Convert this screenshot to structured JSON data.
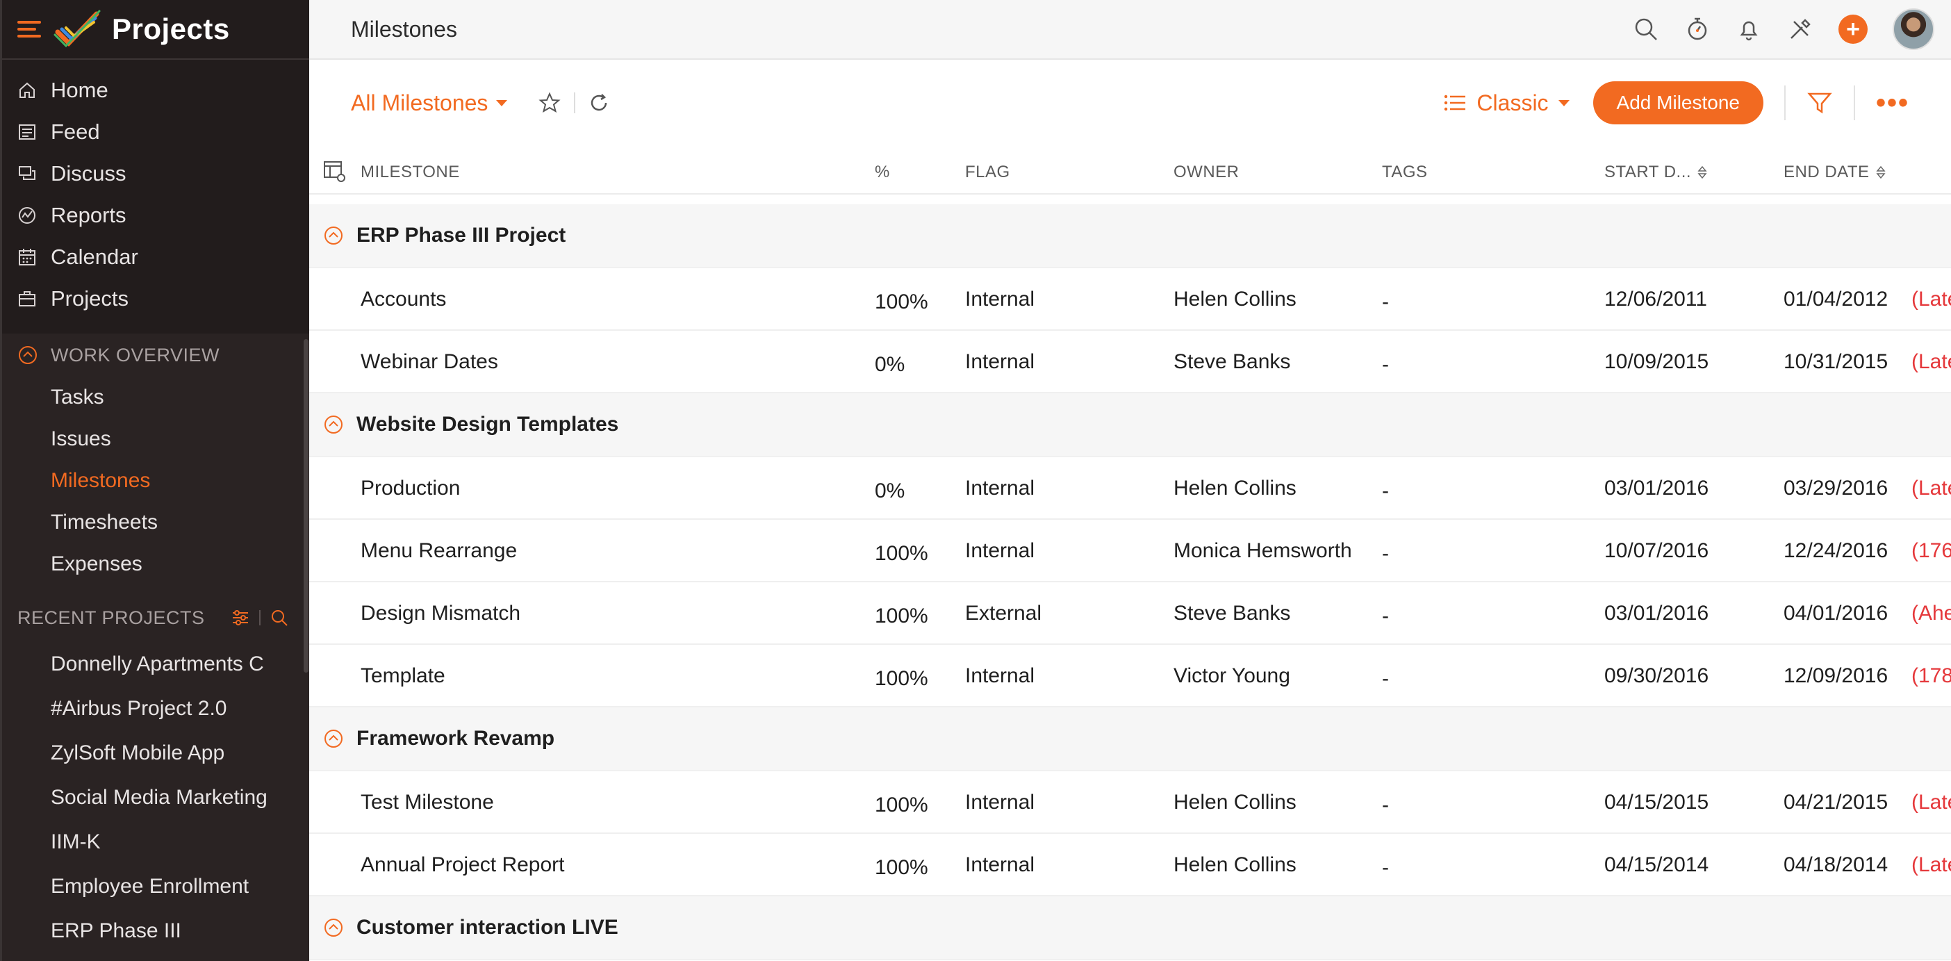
{
  "app": {
    "title": "Projects"
  },
  "sidebar": {
    "nav": [
      {
        "label": "Home",
        "icon": "home-icon"
      },
      {
        "label": "Feed",
        "icon": "feed-icon"
      },
      {
        "label": "Discuss",
        "icon": "discuss-icon"
      },
      {
        "label": "Reports",
        "icon": "reports-icon"
      },
      {
        "label": "Calendar",
        "icon": "calendar-icon"
      },
      {
        "label": "Projects",
        "icon": "projects-icon"
      }
    ],
    "work_overview": {
      "title": "WORK OVERVIEW",
      "items": [
        {
          "label": "Tasks",
          "active": false
        },
        {
          "label": "Issues",
          "active": false
        },
        {
          "label": "Milestones",
          "active": true
        },
        {
          "label": "Timesheets",
          "active": false
        },
        {
          "label": "Expenses",
          "active": false
        }
      ]
    },
    "recent_projects": {
      "title": "RECENT PROJECTS",
      "items": [
        "Donnelly Apartments C",
        "#Airbus Project 2.0",
        "ZylSoft Mobile App",
        "Social Media Marketing",
        "IIM-K",
        "Employee Enrollment",
        "ERP Phase III"
      ]
    }
  },
  "topbar": {
    "page_title": "Milestones"
  },
  "toolbar": {
    "view_label": "All Milestones",
    "layout_label": "Classic",
    "add_button": "Add Milestone"
  },
  "table": {
    "headers": {
      "milestone": "MILESTONE",
      "percent": "%",
      "flag": "FLAG",
      "owner": "OWNER",
      "tags": "TAGS",
      "start": "START D...",
      "end": "END DATE"
    },
    "groups": [
      {
        "name": "ERP Phase III Project",
        "rows": [
          {
            "name": "Accounts",
            "pct": "100%",
            "flag": "Internal",
            "owner": "Helen Collins",
            "tags": "-",
            "start": "12/06/2011",
            "end": "01/04/2012",
            "status": "(Late"
          },
          {
            "name": "Webinar Dates",
            "pct": "0%",
            "flag": "Internal",
            "owner": "Steve Banks",
            "tags": "-",
            "start": "10/09/2015",
            "end": "10/31/2015",
            "status": "(Late"
          }
        ]
      },
      {
        "name": "Website Design Templates",
        "rows": [
          {
            "name": "Production",
            "pct": "0%",
            "flag": "Internal",
            "owner": "Helen Collins",
            "tags": "-",
            "start": "03/01/2016",
            "end": "03/29/2016",
            "status": "(Late"
          },
          {
            "name": "Menu Rearrange",
            "pct": "100%",
            "flag": "Internal",
            "owner": "Monica Hemsworth",
            "tags": "-",
            "start": "10/07/2016",
            "end": "12/24/2016",
            "status": "(176"
          },
          {
            "name": "Design Mismatch",
            "pct": "100%",
            "flag": "External",
            "owner": "Steve Banks",
            "tags": "-",
            "start": "03/01/2016",
            "end": "04/01/2016",
            "status": "(Ahe"
          },
          {
            "name": "Template",
            "pct": "100%",
            "flag": "Internal",
            "owner": "Victor Young",
            "tags": "-",
            "start": "09/30/2016",
            "end": "12/09/2016",
            "status": "(178"
          }
        ]
      },
      {
        "name": "Framework Revamp",
        "rows": [
          {
            "name": "Test Milestone",
            "pct": "100%",
            "flag": "Internal",
            "owner": "Helen Collins",
            "tags": "-",
            "start": "04/15/2015",
            "end": "04/21/2015",
            "status": "(Late"
          },
          {
            "name": "Annual Project Report",
            "pct": "100%",
            "flag": "Internal",
            "owner": "Helen Collins",
            "tags": "-",
            "start": "04/15/2014",
            "end": "04/18/2014",
            "status": "(Late"
          }
        ]
      },
      {
        "name": "Customer interaction LIVE",
        "rows": []
      }
    ]
  },
  "colors": {
    "accent": "#f26a21",
    "sidebar_bg": "#221c1c",
    "late": "#e5383b",
    "ahead": "#2e9e3a"
  }
}
